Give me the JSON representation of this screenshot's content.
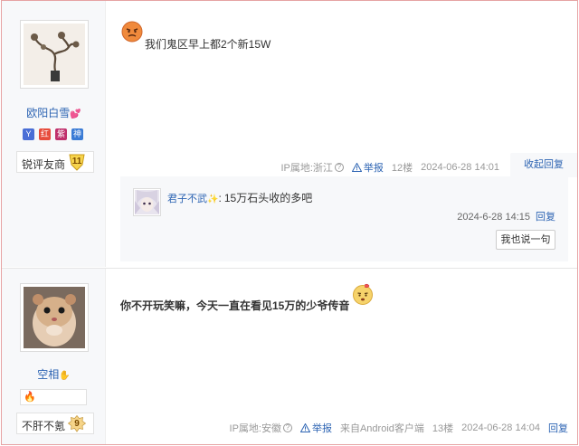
{
  "colors": {
    "link": "#2d64b3",
    "meta": "#999999",
    "border_accent": "#e6a3a3"
  },
  "post1": {
    "user": {
      "name": "欧阳白雪",
      "decor_icon": "heart-icon",
      "level_title": "锐评友商",
      "level": "11"
    },
    "badges": [
      {
        "icon": "badge-y-icon",
        "label": "Y",
        "color": "#4a6ed6"
      },
      {
        "icon": "badge-red-icon",
        "label": "红",
        "color": "#e74c3c"
      },
      {
        "icon": "badge-purple-icon",
        "label": "紫",
        "color": "#c0306c"
      },
      {
        "icon": "badge-god-icon",
        "label": "神",
        "color": "#3a7bd5"
      }
    ],
    "text": "我们鬼区早上都2个新15W",
    "ip_label": "IP属地:浙江",
    "report": "举报",
    "floor": "12楼",
    "time": "2024-06-28 14:01",
    "collapse": "收起回复",
    "reply": {
      "user": "君子不武",
      "colon": ":",
      "text": "15万石头收的多吧",
      "time": "2024-6-28 14:15",
      "reply_label": "回复",
      "say_button": "我也说一句"
    }
  },
  "post2": {
    "user": {
      "name": "空相",
      "level_title": "不肝不氪",
      "level": "9"
    },
    "text": "你不开玩笑嘛，今天一直在看见15万的少爷传音",
    "ip_label": "IP属地:安徽",
    "report": "举报",
    "client": "来自Android客户端",
    "floor": "13楼",
    "time": "2024-06-28 14:04",
    "reply_label": "回复"
  }
}
